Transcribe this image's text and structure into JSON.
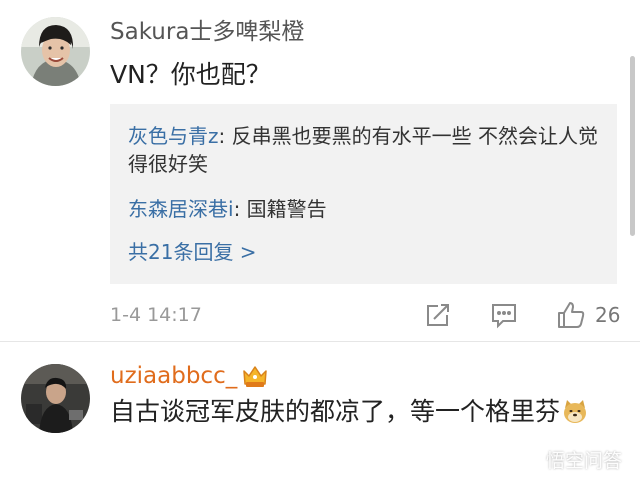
{
  "comments": [
    {
      "username": "Sakura士多啤梨橙",
      "text": "VN？你也配？",
      "avatar": "avatar-woman-photo"
    },
    {
      "username": "uziaabbcc_",
      "text": "自古谈冠军皮肤的都凉了，等一个格里芬",
      "badge": "crown-badge",
      "emoji": "doge-emoji",
      "avatar": "avatar-man-photo"
    }
  ],
  "replies": [
    {
      "author": "灰色与青z",
      "sep": ": ",
      "text": "反串黑也要黑的有水平一些 不然会让人觉得很好笑"
    },
    {
      "author": "东森居深巷i",
      "sep": ": ",
      "text": "国籍警告"
    }
  ],
  "more_replies": "共21条回复 >",
  "meta": {
    "time": "1-4 14:17",
    "like_count": "26"
  },
  "icons": [
    "share-icon",
    "comment-icon",
    "like-icon"
  ],
  "watermark": {
    "text": "悟空问答",
    "icon": "watermark-logo-icon"
  },
  "colors": {
    "link": "#3a6fa5",
    "orange_username": "#e06c1c",
    "reply_bg": "#f2f2f2",
    "meta_gray": "#999999"
  }
}
